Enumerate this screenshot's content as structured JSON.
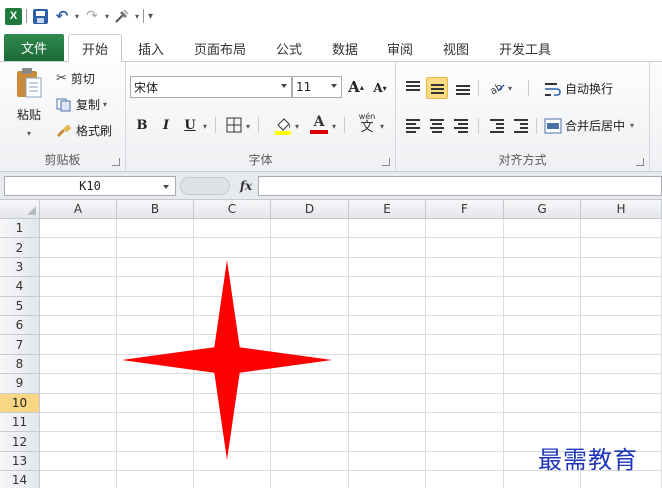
{
  "quick_access": {
    "app_icon": "X",
    "icons": [
      "excel-icon",
      "save-icon",
      "undo-icon",
      "redo-icon",
      "tools-icon",
      "customize-icon"
    ]
  },
  "tabs": {
    "file": "文件",
    "items": [
      {
        "label": "开始",
        "active": true
      },
      {
        "label": "插入"
      },
      {
        "label": "页面布局"
      },
      {
        "label": "公式"
      },
      {
        "label": "数据"
      },
      {
        "label": "审阅"
      },
      {
        "label": "视图"
      },
      {
        "label": "开发工具"
      }
    ]
  },
  "ribbon": {
    "clipboard": {
      "label": "剪贴板",
      "paste": "粘贴",
      "cut": "剪切",
      "copy": "复制",
      "format_painter": "格式刷"
    },
    "font": {
      "label": "字体",
      "font_name": "宋体",
      "font_size": "11",
      "bold": "B",
      "italic": "I",
      "underline": "U",
      "grow": "A",
      "shrink": "A",
      "phonetic": "wén",
      "phonetic_char": "文"
    },
    "alignment": {
      "label": "对齐方式",
      "wrap_text": "自动换行",
      "merge_center": "合并后居中"
    }
  },
  "formula_bar": {
    "name_box": "K10",
    "fx": "fx",
    "value": ""
  },
  "sheet": {
    "columns": [
      "A",
      "B",
      "C",
      "D",
      "E",
      "F",
      "G",
      "H"
    ],
    "rows": [
      "1",
      "2",
      "3",
      "4",
      "5",
      "6",
      "7",
      "8",
      "9",
      "10",
      "11",
      "12",
      "13",
      "14"
    ],
    "active_row": "10",
    "shape": {
      "type": "four-point-star",
      "fill": "#ff0000"
    }
  },
  "colors": {
    "file_tab": "#217346",
    "active_row_header": "#f8d683",
    "star": "#ff0000",
    "watermark": "#1f36b8"
  },
  "watermark": "最需教育"
}
